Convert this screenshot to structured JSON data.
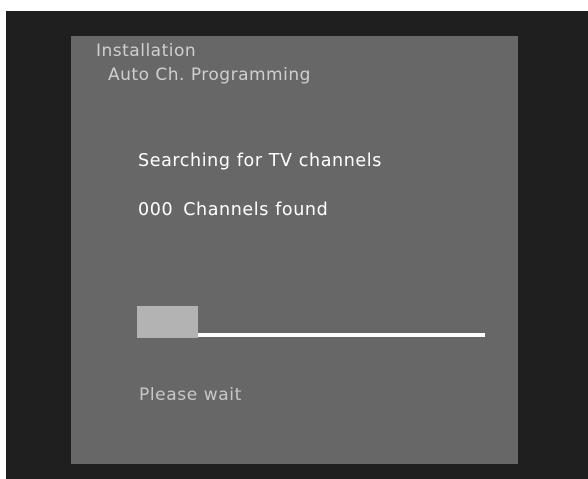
{
  "menu": {
    "title": "Installation",
    "subtitle": "Auto Ch. Programming"
  },
  "search": {
    "status": "Searching for TV channels",
    "channel_count": "000",
    "channels_found_label": "Channels found",
    "progress_fraction": 0.175
  },
  "footer": {
    "wait_message": "Please wait"
  },
  "colors": {
    "screen_background": "#676767",
    "outer_frame": "#1f1f1f",
    "progress_fill": "#b3b3b3",
    "progress_track": "#ffffff",
    "text_primary": "#ffffff",
    "text_secondary": "#cfcfcf"
  }
}
